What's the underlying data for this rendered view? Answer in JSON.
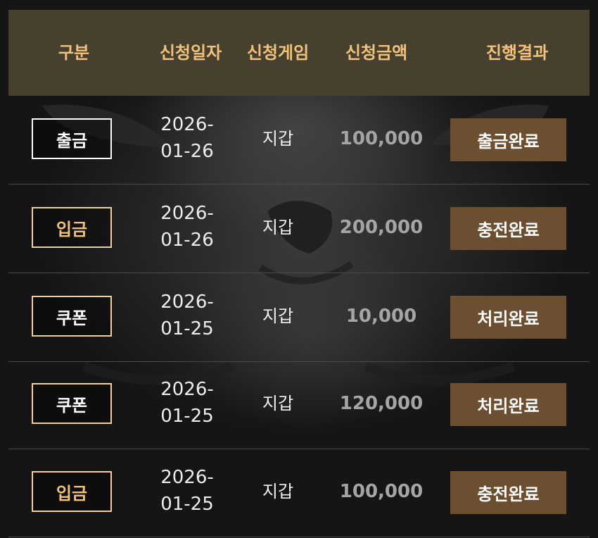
{
  "header": {
    "type": "구분",
    "date": "신청일자",
    "game": "신청게임",
    "amount": "신청금액",
    "result": "진행결과"
  },
  "colors": {
    "header_bg": "#47402f",
    "header_text": "#f0c27c",
    "status_bg": "#6c4f31",
    "withdraw_border": "#ffffff",
    "deposit_border": "#f3cf9e"
  },
  "rows": [
    {
      "type": "출금",
      "date": "2026-01-26",
      "game": "지갑",
      "amount": "100,000",
      "status": "출금완료"
    },
    {
      "type": "입금",
      "date": "2026-01-26",
      "game": "지갑",
      "amount": "200,000",
      "status": "충전완료"
    },
    {
      "type": "쿠폰",
      "date": "2026-01-25",
      "game": "지갑",
      "amount": "10,000",
      "status": "처리완료"
    },
    {
      "type": "쿠폰",
      "date": "2026-01-25",
      "game": "지갑",
      "amount": "120,000",
      "status": "처리완료"
    },
    {
      "type": "입금",
      "date": "2026-01-25",
      "game": "지갑",
      "amount": "100,000",
      "status": "충전완료"
    }
  ]
}
